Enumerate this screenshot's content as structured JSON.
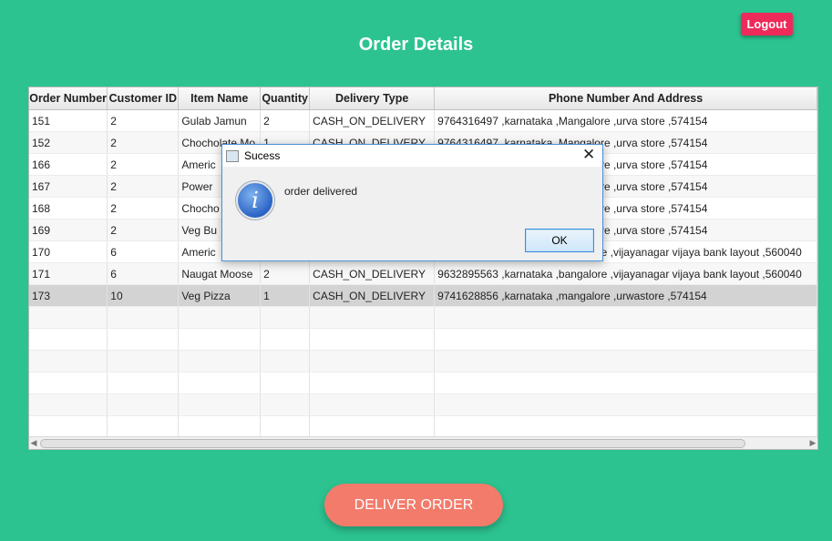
{
  "header": {
    "title": "Order Details",
    "logout_label": "Logout"
  },
  "table": {
    "columns": [
      "Order Number",
      "Customer ID",
      "Item Name",
      "Quantity",
      "Delivery Type",
      "Phone Number And Address"
    ],
    "rows": [
      [
        "151",
        "2",
        "Gulab Jamun",
        "2",
        "CASH_ON_DELIVERY",
        "9764316497 ,karnataka ,Mangalore ,urva store ,574154"
      ],
      [
        "152",
        "2",
        "Chocholate Mo",
        "1",
        "CASH_ON_DELIVERY",
        "9764316497 ,karnataka ,Mangalore ,urva store ,574154"
      ],
      [
        "166",
        "2",
        "Americ",
        "",
        "",
        "9764316497 ,karnataka ,Mangalore ,urva store ,574154"
      ],
      [
        "167",
        "2",
        "Power",
        "",
        "",
        "9764316497 ,karnataka ,Mangalore ,urva store ,574154"
      ],
      [
        "168",
        "2",
        "Chocho",
        "",
        "",
        "9764316497 ,karnataka ,Mangalore ,urva store ,574154"
      ],
      [
        "169",
        "2",
        "Veg Bu",
        "",
        "",
        "9764316497 ,karnataka ,Mangalore ,urva store ,574154"
      ],
      [
        "170",
        "6",
        "Americ",
        "",
        "",
        "9632895563 ,karnataka ,bangalore ,vijayanagar vijaya bank layout ,560040"
      ],
      [
        "171",
        "6",
        "Naugat Moose",
        "2",
        "CASH_ON_DELIVERY",
        "9632895563 ,karnataka ,bangalore ,vijayanagar vijaya bank layout ,560040"
      ],
      [
        "173",
        "10",
        "Veg Pizza",
        "1",
        "CASH_ON_DELIVERY",
        "9741628856 ,karnataka ,mangalore ,urwastore ,574154"
      ]
    ],
    "selected_row_index": 8,
    "empty_rows": 6
  },
  "actions": {
    "deliver_label": "DELIVER ORDER"
  },
  "dialog": {
    "title": "Sucess",
    "message": "order delivered",
    "ok_label": "OK",
    "close_glyph": "✕",
    "icon": "info-icon"
  },
  "colors": {
    "background": "#2cc390",
    "logout": "#ee2a5a",
    "deliver": "#f27b6b"
  }
}
